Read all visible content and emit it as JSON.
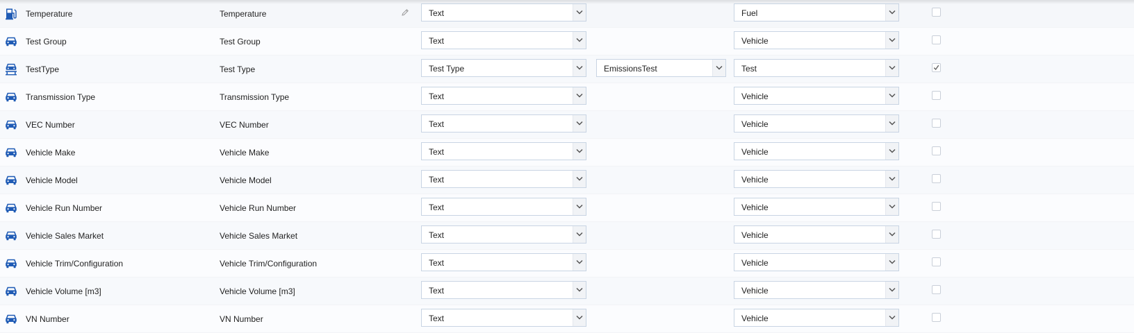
{
  "rows": [
    {
      "icon": "fuel-pump-icon",
      "name": "Temperature",
      "label": "Temperature",
      "editable": true,
      "type": "Text",
      "subtype": null,
      "category": "Fuel",
      "checked": false
    },
    {
      "icon": "car-icon",
      "name": "Test Group",
      "label": "Test Group",
      "editable": false,
      "type": "Text",
      "subtype": null,
      "category": "Vehicle",
      "checked": false
    },
    {
      "icon": "car-lift-icon",
      "name": "TestType",
      "label": "Test Type",
      "editable": false,
      "type": "Test Type",
      "subtype": "EmissionsTest",
      "category": "Test",
      "checked": true
    },
    {
      "icon": "car-icon",
      "name": "Transmission Type",
      "label": "Transmission Type",
      "editable": false,
      "type": "Text",
      "subtype": null,
      "category": "Vehicle",
      "checked": false
    },
    {
      "icon": "car-icon",
      "name": "VEC Number",
      "label": "VEC Number",
      "editable": false,
      "type": "Text",
      "subtype": null,
      "category": "Vehicle",
      "checked": false
    },
    {
      "icon": "car-icon",
      "name": "Vehicle Make",
      "label": "Vehicle Make",
      "editable": false,
      "type": "Text",
      "subtype": null,
      "category": "Vehicle",
      "checked": false
    },
    {
      "icon": "car-icon",
      "name": "Vehicle Model",
      "label": "Vehicle Model",
      "editable": false,
      "type": "Text",
      "subtype": null,
      "category": "Vehicle",
      "checked": false
    },
    {
      "icon": "car-icon",
      "name": "Vehicle Run Number",
      "label": "Vehicle Run Number",
      "editable": false,
      "type": "Text",
      "subtype": null,
      "category": "Vehicle",
      "checked": false
    },
    {
      "icon": "car-icon",
      "name": "Vehicle Sales Market",
      "label": "Vehicle Sales Market",
      "editable": false,
      "type": "Text",
      "subtype": null,
      "category": "Vehicle",
      "checked": false
    },
    {
      "icon": "car-icon",
      "name": "Vehicle Trim/Configuration",
      "label": "Vehicle Trim/Configuration",
      "editable": false,
      "type": "Text",
      "subtype": null,
      "category": "Vehicle",
      "checked": false
    },
    {
      "icon": "car-icon",
      "name": "Vehicle Volume [m3]",
      "label": "Vehicle Volume [m3]",
      "editable": false,
      "type": "Text",
      "subtype": null,
      "category": "Vehicle",
      "checked": false
    },
    {
      "icon": "car-icon",
      "name": "VN Number",
      "label": "VN Number",
      "editable": false,
      "type": "Text",
      "subtype": null,
      "category": "Vehicle",
      "checked": false
    }
  ],
  "colors": {
    "icon": "#1f5bb5",
    "select_border": "#c8d4e3",
    "text": "#222222"
  }
}
